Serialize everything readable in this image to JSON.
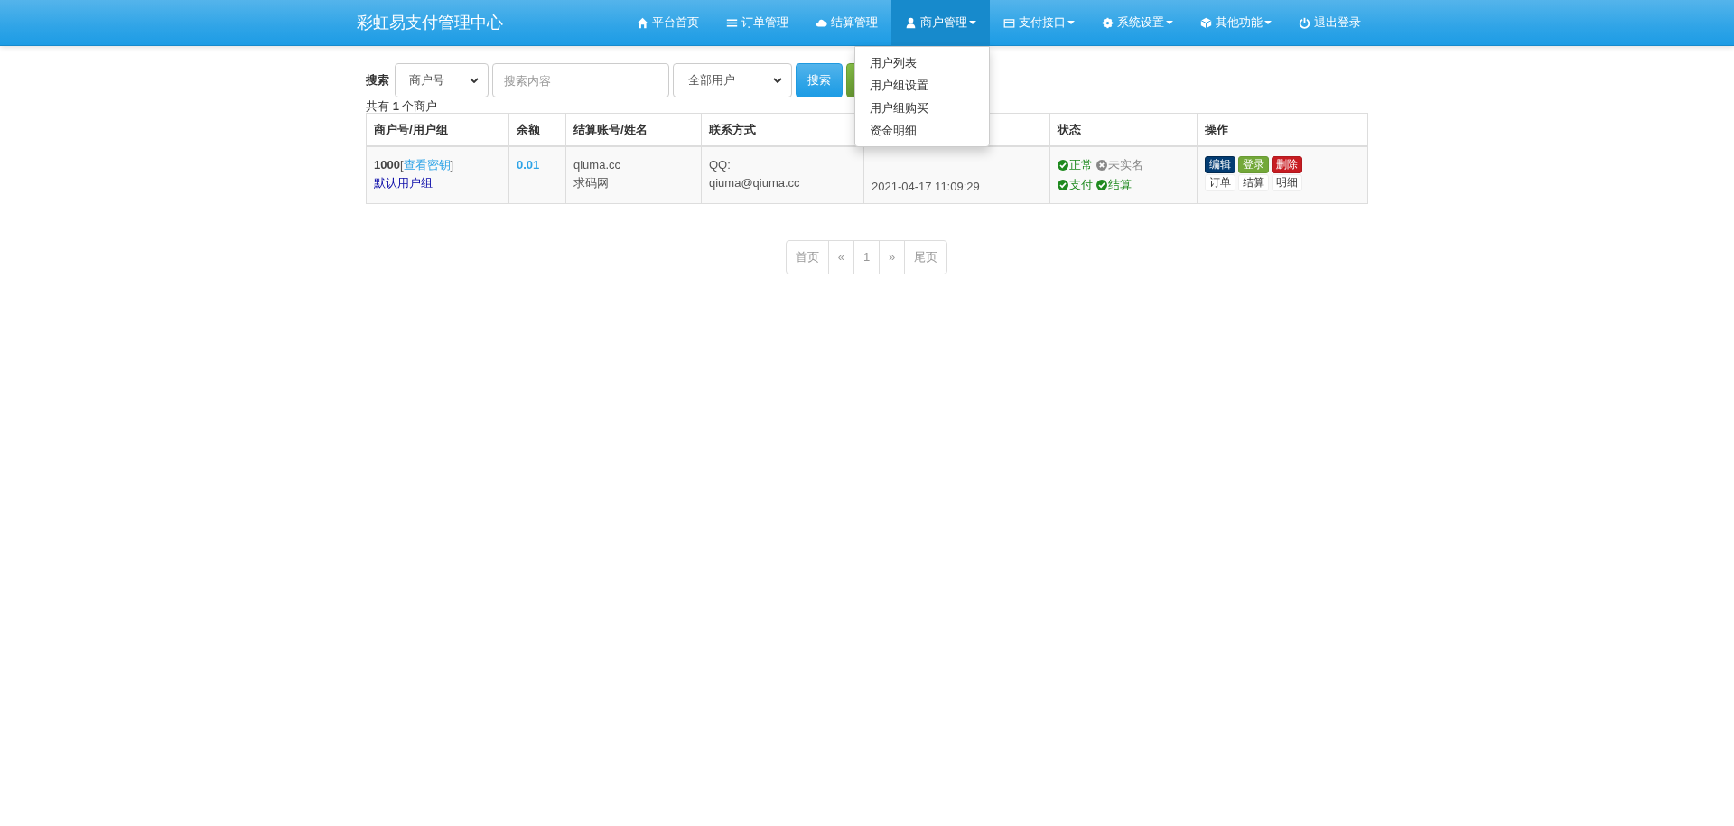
{
  "navbar": {
    "brand": "彩虹易支付管理中心",
    "items": [
      {
        "label": "平台首页",
        "kind": "home",
        "dropdown": false,
        "selected": false
      },
      {
        "label": "订单管理",
        "kind": "list",
        "dropdown": false,
        "selected": false
      },
      {
        "label": "结算管理",
        "kind": "cloud",
        "dropdown": false,
        "selected": false
      },
      {
        "label": "商户管理",
        "kind": "user",
        "dropdown": true,
        "selected": true,
        "menu": [
          "用户列表",
          "用户组设置",
          "用户组购买",
          "资金明细"
        ]
      },
      {
        "label": "支付接口",
        "kind": "card",
        "dropdown": true,
        "selected": false
      },
      {
        "label": "系统设置",
        "kind": "gear",
        "dropdown": true,
        "selected": false
      },
      {
        "label": "其他功能",
        "kind": "cube",
        "dropdown": true,
        "selected": false
      },
      {
        "label": "退出登录",
        "kind": "power",
        "dropdown": false,
        "selected": false
      }
    ]
  },
  "search": {
    "label": "搜索",
    "field_select": "商户号",
    "placeholder": "搜索内容",
    "group_select": "全部用户",
    "buttons": [
      {
        "label": "搜索",
        "kind": "primary"
      },
      {
        "kind": "success"
      }
    ]
  },
  "summary": {
    "prefix": "共有 ",
    "count": "1",
    "suffix": " 个商户"
  },
  "table": {
    "columns": [
      {
        "label": "商户号/用户组"
      },
      {
        "label": "余额"
      },
      {
        "label": "结算账号/姓名"
      },
      {
        "label": "联系方式"
      },
      {},
      {
        "label": "状态"
      },
      {
        "label": "操作"
      }
    ],
    "rows": [
      {
        "id": "1000",
        "bracket_open": "[",
        "key_link": "查看密钥",
        "bracket_close": "]",
        "group": "默认用户组",
        "balance": "0.01",
        "settle_account": "qiuma.cc",
        "settle_name": "求码网",
        "contact_label": "QQ:",
        "contact": "qiuma@qiuma.cc",
        "date": "2021-04-17 11:09:29",
        "status": [
          [
            {
              "label": "正常",
              "ok": true
            },
            {
              "label": "未实名",
              "ok": false
            }
          ],
          [
            {
              "label": "支付",
              "ok": true
            },
            {
              "label": "结算",
              "ok": true
            }
          ]
        ],
        "actions": [
          [
            {
              "label": "编辑",
              "kind": "primary"
            },
            {
              "label": "登录",
              "kind": "success"
            },
            {
              "label": "删除",
              "kind": "danger"
            }
          ],
          [
            {
              "label": "订单",
              "kind": "default"
            },
            {
              "label": "结算",
              "kind": "default"
            },
            {
              "label": "明细",
              "kind": "default"
            }
          ]
        ]
      }
    ]
  },
  "pagination": [
    {
      "label": "首页"
    },
    {
      "label": "«"
    },
    {
      "label": "1"
    },
    {
      "label": "»"
    },
    {
      "label": "尾页"
    }
  ]
}
